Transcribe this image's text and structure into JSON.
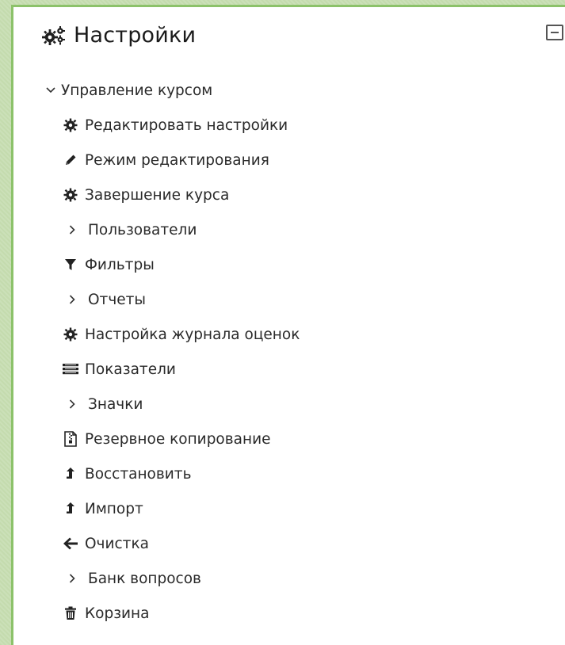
{
  "block": {
    "title": "Настройки",
    "header_icon": "gears-icon",
    "collapse_icon": "collapse-icon"
  },
  "menu": {
    "parent": {
      "label": "Управление курсом",
      "icon": "chevron-down-icon",
      "expanded": true
    },
    "items": [
      {
        "label": "Редактировать настройки",
        "icon": "gear-icon"
      },
      {
        "label": "Режим редактирования",
        "icon": "pencil-icon"
      },
      {
        "label": "Завершение курса",
        "icon": "gear-icon"
      },
      {
        "label": "Пользователи",
        "icon": "chevron-right-icon",
        "expandable": true
      },
      {
        "label": "Фильтры",
        "icon": "filter-icon"
      },
      {
        "label": "Отчеты",
        "icon": "chevron-right-icon",
        "expandable": true
      },
      {
        "label": "Настройка журнала оценок",
        "icon": "gear-icon"
      },
      {
        "label": "Показатели",
        "icon": "list-icon"
      },
      {
        "label": "Значки",
        "icon": "chevron-right-icon",
        "expandable": true
      },
      {
        "label": "Резервное копирование",
        "icon": "archive-file-icon"
      },
      {
        "label": "Восстановить",
        "icon": "upload-arrow-icon"
      },
      {
        "label": "Импорт",
        "icon": "upload-arrow-icon"
      },
      {
        "label": "Очистка",
        "icon": "arrow-left-icon"
      },
      {
        "label": "Банк вопросов",
        "icon": "chevron-right-icon",
        "expandable": true
      },
      {
        "label": "Корзина",
        "icon": "trash-icon"
      }
    ]
  }
}
